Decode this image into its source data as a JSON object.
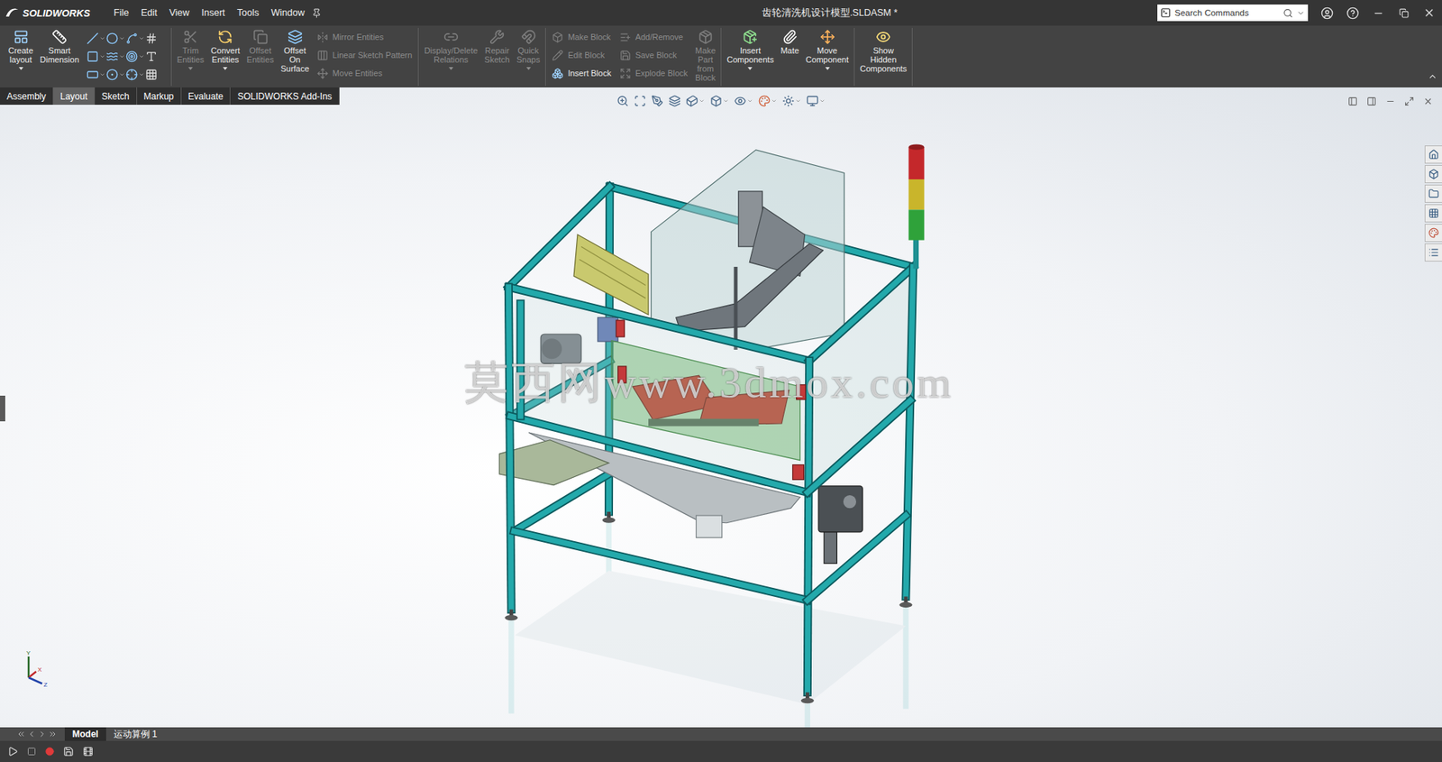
{
  "window": {
    "title": "齿轮清洗机设计模型.SLDASM *",
    "app": "SOLIDWORKS"
  },
  "menu": [
    "File",
    "Edit",
    "View",
    "Insert",
    "Tools",
    "Window"
  ],
  "search": {
    "placeholder": "Search Commands"
  },
  "ribbon": [
    [
      {
        "kind": "large",
        "lines": [
          "Create",
          "layout"
        ],
        "disabled": false,
        "dropdown": true
      },
      {
        "kind": "large",
        "lines": [
          "Smart",
          "Dimension"
        ],
        "disabled": false,
        "dropdown": false
      },
      {
        "kind": "grid"
      }
    ],
    [
      {
        "kind": "large",
        "lines": [
          "Trim",
          "Entities"
        ],
        "disabled": true,
        "dropdown": true
      },
      {
        "kind": "large",
        "lines": [
          "Convert",
          "Entities"
        ],
        "disabled": false,
        "dropdown": true
      },
      {
        "kind": "large",
        "lines": [
          "Offset",
          "Entities"
        ],
        "disabled": true,
        "dropdown": false
      },
      {
        "kind": "large",
        "lines": [
          "Offset",
          "On",
          "Surface"
        ],
        "disabled": false,
        "dropdown": false
      },
      {
        "kind": "stack",
        "items": [
          {
            "label": "Mirror Entities",
            "disabled": true
          },
          {
            "label": "Linear Sketch Pattern",
            "disabled": true
          },
          {
            "label": "Move Entities",
            "disabled": true
          }
        ]
      }
    ],
    [
      {
        "kind": "large",
        "lines": [
          "Display/Delete",
          "Relations"
        ],
        "disabled": true,
        "dropdown": true
      },
      {
        "kind": "large",
        "lines": [
          "Repair",
          "Sketch"
        ],
        "disabled": true,
        "dropdown": false
      },
      {
        "kind": "large",
        "lines": [
          "Quick",
          "Snaps"
        ],
        "disabled": true,
        "dropdown": true
      }
    ],
    [
      {
        "kind": "stack",
        "items": [
          {
            "label": "Make Block",
            "disabled": true
          },
          {
            "label": "Edit Block",
            "disabled": true
          },
          {
            "label": "Insert Block",
            "disabled": false
          }
        ]
      },
      {
        "kind": "stack",
        "items": [
          {
            "label": "Add/Remove",
            "disabled": true
          },
          {
            "label": "Save Block",
            "disabled": true
          },
          {
            "label": "Explode Block",
            "disabled": true
          }
        ]
      },
      {
        "kind": "large",
        "lines": [
          "Make",
          "Part",
          "from",
          "Block"
        ],
        "disabled": true,
        "dropdown": false
      }
    ],
    [
      {
        "kind": "large",
        "lines": [
          "Insert",
          "Components"
        ],
        "disabled": false,
        "dropdown": true
      },
      {
        "kind": "large",
        "lines": [
          "Mate"
        ],
        "disabled": false,
        "dropdown": false
      },
      {
        "kind": "large",
        "lines": [
          "Move",
          "Component"
        ],
        "disabled": false,
        "dropdown": true
      }
    ],
    [
      {
        "kind": "large",
        "lines": [
          "Show",
          "Hidden",
          "Components"
        ],
        "disabled": false,
        "dropdown": false
      }
    ]
  ],
  "tabs": [
    {
      "label": "Assembly",
      "selected": false
    },
    {
      "label": "Layout",
      "selected": true
    },
    {
      "label": "Sketch",
      "selected": false
    },
    {
      "label": "Markup",
      "selected": false
    },
    {
      "label": "Evaluate",
      "selected": false
    },
    {
      "label": "SOLIDWORKS Add-Ins",
      "selected": false
    }
  ],
  "watermark": "莫西网www.3dmox.com",
  "triad": {
    "y": "Y",
    "x": "X",
    "z": "Z"
  },
  "bottom_tabs": [
    {
      "label": "Model",
      "selected": true
    },
    {
      "label": "运动算例 1",
      "selected": false
    }
  ]
}
